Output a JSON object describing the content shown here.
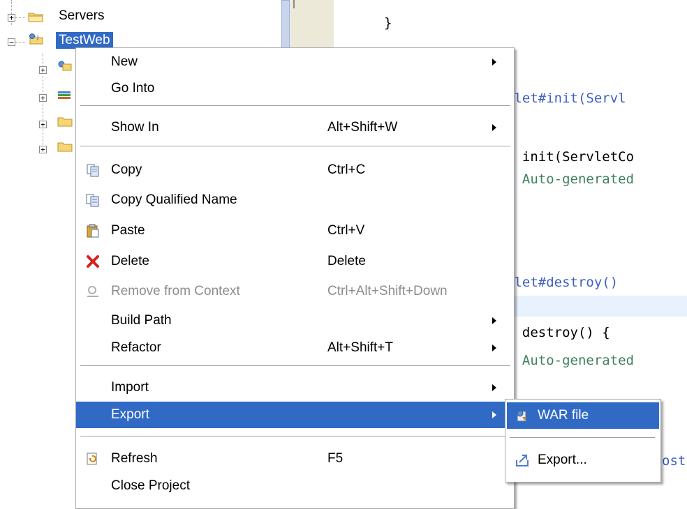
{
  "explorer": {
    "nodes": [
      {
        "label": "Servers",
        "expander": "+"
      },
      {
        "label": "TestWeb",
        "expander": "−"
      }
    ],
    "child_expanders": [
      "+",
      "+",
      "+",
      "+"
    ]
  },
  "editor": {
    "lines": [
      {
        "text": "}",
        "style": "plain"
      },
      {
        "text": "vlet#init(Servl",
        "style": "doc"
      },
      {
        "text": "l init(ServletCo",
        "style": "plain"
      },
      {
        "text": "  Auto-generated",
        "style": "green"
      },
      {
        "text": "vlet#destroy()",
        "style": "doc"
      },
      {
        "text": "l destroy() {",
        "style": "plain"
      },
      {
        "text": "  Auto-generated",
        "style": "green"
      },
      {
        "text": "ost",
        "style": "doc"
      }
    ]
  },
  "context_menu": {
    "items": [
      {
        "label": "New",
        "shortcut": "",
        "submenu": true
      },
      {
        "label": "Go Into",
        "shortcut": "",
        "submenu": false
      },
      {
        "label": "Show In",
        "shortcut": "Alt+Shift+W",
        "submenu": true
      },
      {
        "label": "Copy",
        "shortcut": "Ctrl+C",
        "icon": "copy-icon"
      },
      {
        "label": "Copy Qualified Name",
        "shortcut": "",
        "icon": "copy-qualified-name-icon"
      },
      {
        "label": "Paste",
        "shortcut": "Ctrl+V",
        "icon": "paste-icon"
      },
      {
        "label": "Delete",
        "shortcut": "Delete",
        "icon": "delete-icon"
      },
      {
        "label": "Remove from Context",
        "shortcut": "Ctrl+Alt+Shift+Down",
        "icon": "remove-from-context-icon",
        "disabled": true
      },
      {
        "label": "Build Path",
        "shortcut": "",
        "submenu": true
      },
      {
        "label": "Refactor",
        "shortcut": "Alt+Shift+T",
        "submenu": true
      },
      {
        "label": "Import",
        "shortcut": "",
        "submenu": true
      },
      {
        "label": "Export",
        "shortcut": "",
        "submenu": true,
        "selected": true
      },
      {
        "label": "Refresh",
        "shortcut": "F5",
        "icon": "refresh-icon"
      },
      {
        "label": "Close Project",
        "shortcut": ""
      }
    ]
  },
  "export_submenu": {
    "items": [
      {
        "label": "WAR file",
        "icon": "war-file-icon",
        "selected": true
      },
      {
        "label": "Export...",
        "icon": "export-icon"
      }
    ]
  },
  "colors": {
    "selection": "#316ac5",
    "code_doc": "#3f5fbf",
    "code_comment": "#3f7f5f",
    "disabled_text": "#8d8d8d"
  }
}
